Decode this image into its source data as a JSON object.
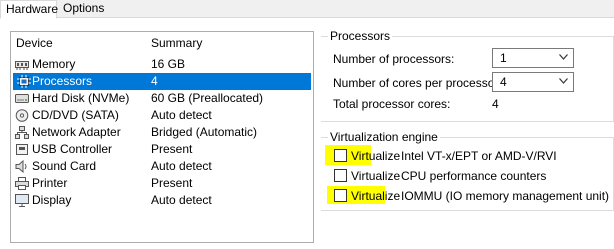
{
  "tabs": [
    {
      "label": "Hardware",
      "active": true
    },
    {
      "label": "Options",
      "active": false
    }
  ],
  "device_list": {
    "columns": [
      "Device",
      "Summary"
    ],
    "rows": [
      {
        "icon": "memory-icon",
        "name": "Memory",
        "summary": "16 GB",
        "selected": false
      },
      {
        "icon": "processor-icon",
        "name": "Processors",
        "summary": "4",
        "selected": true
      },
      {
        "icon": "hard-disk-icon",
        "name": "Hard Disk (NVMe)",
        "summary": "60 GB (Preallocated)",
        "selected": false
      },
      {
        "icon": "cd-dvd-icon",
        "name": "CD/DVD (SATA)",
        "summary": "Auto detect",
        "selected": false
      },
      {
        "icon": "network-adapter-icon",
        "name": "Network Adapter",
        "summary": "Bridged (Automatic)",
        "selected": false
      },
      {
        "icon": "usb-icon",
        "name": "USB Controller",
        "summary": "Present",
        "selected": false
      },
      {
        "icon": "sound-card-icon",
        "name": "Sound Card",
        "summary": "Auto detect",
        "selected": false
      },
      {
        "icon": "printer-icon",
        "name": "Printer",
        "summary": "Present",
        "selected": false
      },
      {
        "icon": "display-icon",
        "name": "Display",
        "summary": "Auto detect",
        "selected": false
      }
    ]
  },
  "processors": {
    "title": "Processors",
    "num_processors_label": "Number of processors:",
    "num_processors_value": "1",
    "cores_label": "Number of cores per processor:",
    "cores_value": "4",
    "total_label": "Total processor cores:",
    "total_value": "4"
  },
  "virtualization": {
    "title": "Virtualization engine",
    "options": [
      {
        "prefix": "Virtualize",
        "label": " Intel VT-x/EPT or AMD-V/RVI",
        "checked": false
      },
      {
        "prefix": "Virtualize",
        "label": " CPU performance counters",
        "checked": false
      },
      {
        "prefix": "Virtualize",
        "label": " IOMMU (IO memory management unit)",
        "checked": false
      }
    ]
  },
  "colors": {
    "selection": "#0078d7",
    "highlight": "#ffff00"
  }
}
